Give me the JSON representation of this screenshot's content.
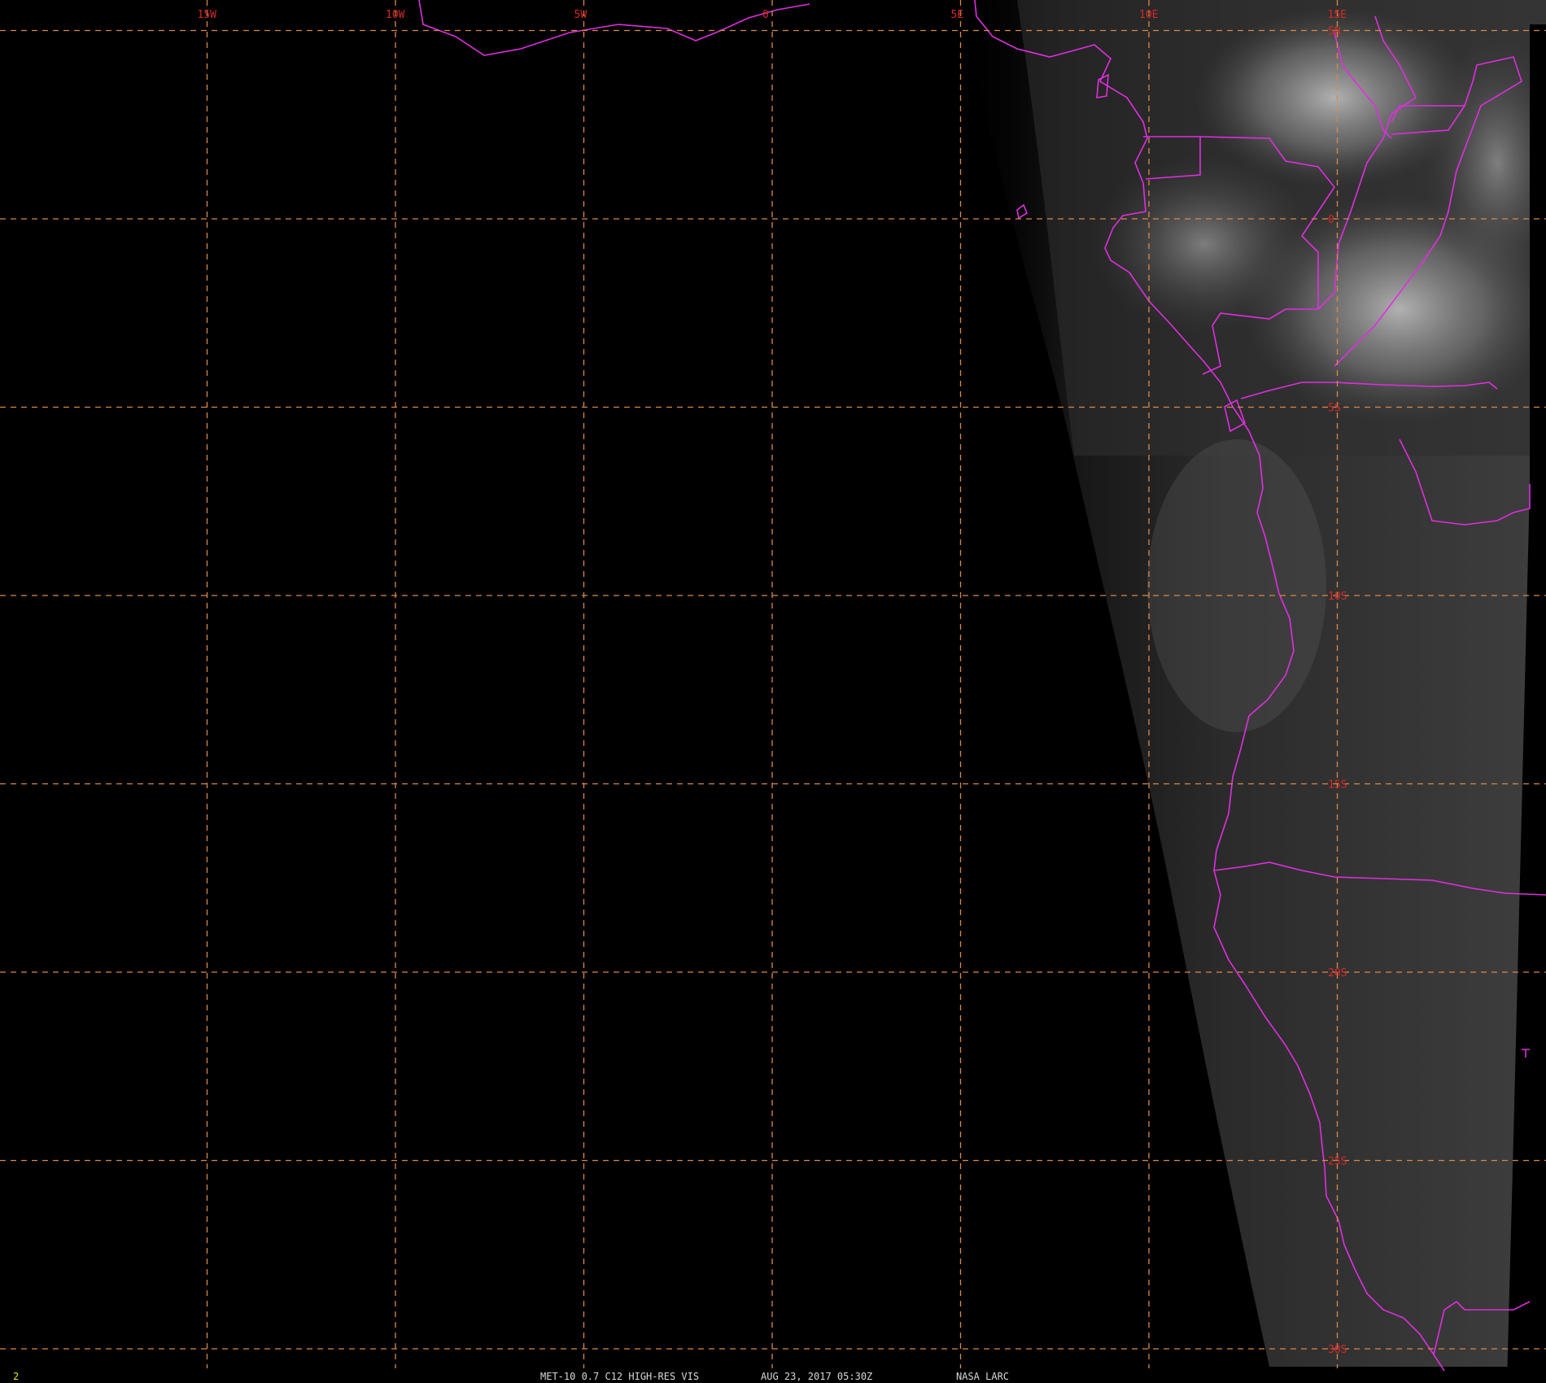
{
  "map": {
    "grid_longitudes": [
      {
        "value": -15,
        "label": "15W"
      },
      {
        "value": -10,
        "label": "10W"
      },
      {
        "value": -5,
        "label": "5W"
      },
      {
        "value": 0,
        "label": "0"
      },
      {
        "value": 5,
        "label": "5E"
      },
      {
        "value": 10,
        "label": "10E"
      },
      {
        "value": 15,
        "label": "15E"
      }
    ],
    "grid_latitudes": [
      {
        "value": 5,
        "label": "5N"
      },
      {
        "value": 0,
        "label": "0"
      },
      {
        "value": -5,
        "label": "5S"
      },
      {
        "value": -10,
        "label": "10S"
      },
      {
        "value": -15,
        "label": "15S"
      },
      {
        "value": -20,
        "label": "20S"
      },
      {
        "value": -25,
        "label": "25S"
      },
      {
        "value": -30,
        "label": "30S"
      }
    ],
    "colors": {
      "background": "#000000",
      "grid": "#d9894a",
      "grid_label": "#d42a2a",
      "boundaries": "#e02ee0",
      "footer_text": "#d8d8d8",
      "frame_number": "#e6e600"
    }
  },
  "footer": {
    "frame_number": "2",
    "product": "MET-10 0.7 C12 HIGH-RES VIS",
    "datetime": "AUG 23, 2017 05:30Z",
    "source": "NASA LARC"
  }
}
